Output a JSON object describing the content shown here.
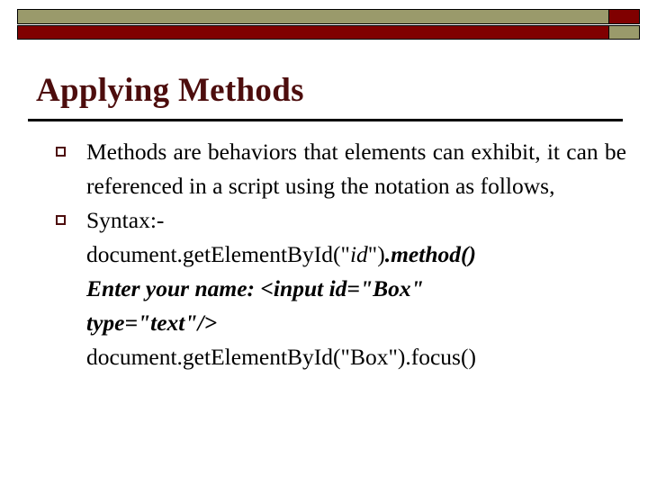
{
  "colors": {
    "olive": "#9a9a6b",
    "dark_red": "#800000",
    "title_maroon": "#4d0d0d",
    "rule_black": "#000000",
    "body_black": "#000000",
    "background": "#ffffff"
  },
  "header": {
    "bar_top_left_color": "#9a9a6b",
    "bar_top_right_color": "#800000",
    "bar_bottom_left_color": "#800000",
    "bar_bottom_right_color": "#9a9a6b"
  },
  "title": {
    "text": "Applying Methods"
  },
  "body": {
    "bullets": [
      {
        "marker": "hollow-square",
        "text": "Methods are behaviors that elements can exhibit, it can be referenced in a script using the notation as follows,"
      },
      {
        "marker": "hollow-square",
        "label": "Syntax:-",
        "lines": [
          {
            "segments": [
              {
                "text": "document.getElementById(\"",
                "style": "regular"
              },
              {
                "text": "id",
                "style": "italic"
              },
              {
                "text": "\")",
                "style": "regular"
              },
              {
                "text": ".method()",
                "style": "bold-italic"
              }
            ]
          },
          {
            "segments": [
              {
                "text": "Enter your name: <input id=\"Box\"",
                "style": "bold-italic"
              }
            ]
          },
          {
            "segments": [
              {
                "text": "type=\"text\"/>",
                "style": "bold-italic"
              }
            ]
          },
          {
            "segments": [
              {
                "text": "document.getElementById(\"Box\").focus()",
                "style": "regular"
              }
            ]
          }
        ]
      }
    ]
  }
}
